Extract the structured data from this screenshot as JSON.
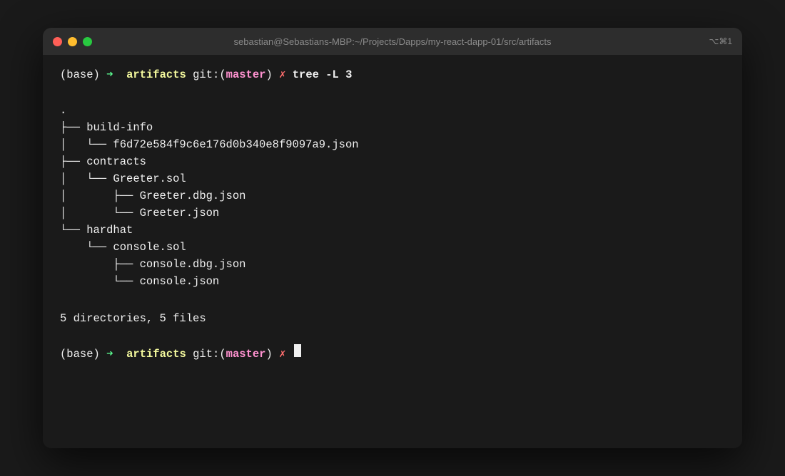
{
  "window": {
    "title": "sebastian@Sebastians-MBP:~/Projects/Dapps/my-react-dapp-01/src/artifacts",
    "shortcut": "⌥⌘1"
  },
  "terminal": {
    "prompt1": {
      "base": "(base)",
      "arrow": "➜",
      "dir": "artifacts",
      "git_label": "git:",
      "git_paren_open": "(",
      "git_branch": "master",
      "git_paren_close": ")",
      "x": "✗",
      "command": "tree -L 3"
    },
    "tree_output": ".\n├── build-info\n│   └── f6d72e584f9c6e176d0b340e8f9097a9.json\n├── contracts\n│   └── Greeter.sol\n│       ├── Greeter.dbg.json\n│       └── Greeter.json\n└── hardhat\n    └── console.sol\n        ├── console.dbg.json\n        └── console.json",
    "summary": "5 directories, 5 files",
    "prompt2": {
      "base": "(base)",
      "arrow": "➜",
      "dir": "artifacts",
      "git_label": "git:",
      "git_paren_open": "(",
      "git_branch": "master",
      "git_paren_close": ")",
      "x": "✗"
    }
  }
}
